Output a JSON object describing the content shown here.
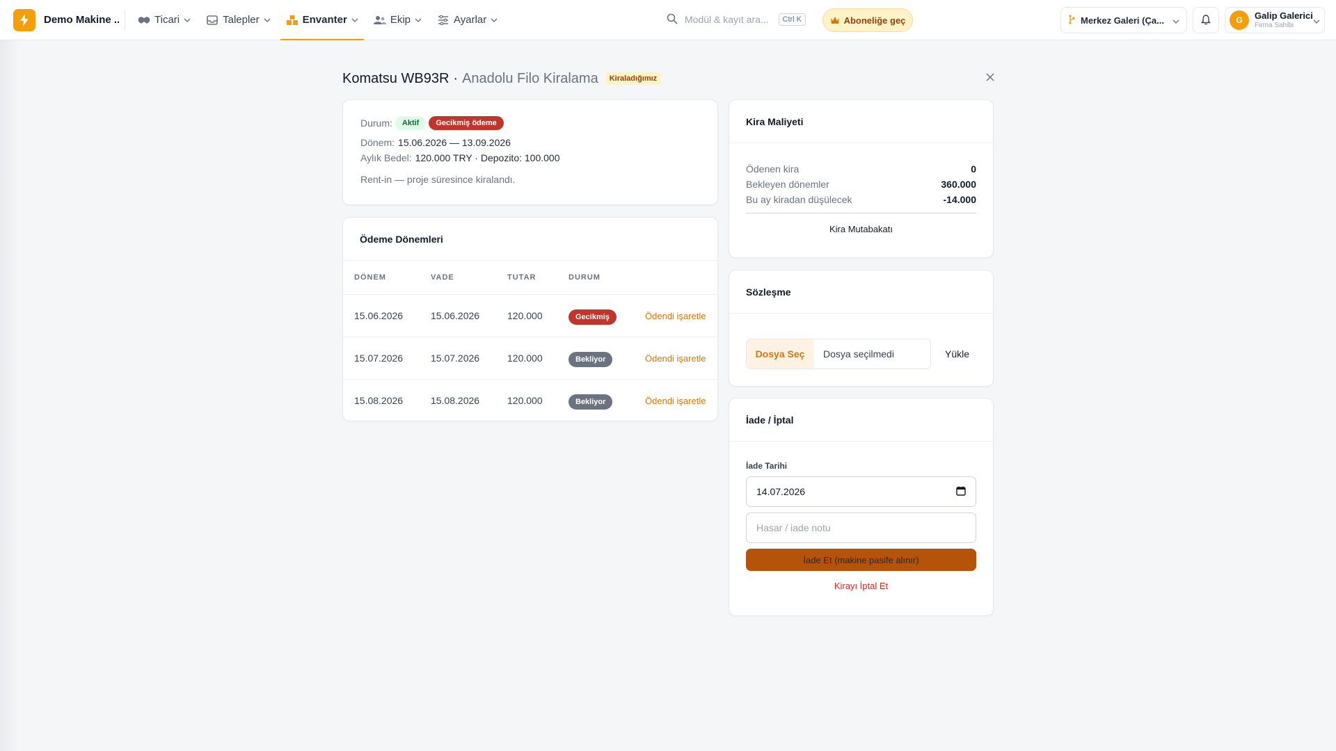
{
  "app": {
    "name": "Demo Makine ...",
    "accent": "#f59e0b"
  },
  "nav": [
    {
      "label": "Ticari",
      "icon": "handshake-icon"
    },
    {
      "label": "Talepler",
      "icon": "inbox-icon"
    },
    {
      "label": "Envanter",
      "icon": "boxes-icon",
      "active": true
    },
    {
      "label": "Ekip",
      "icon": "users-icon"
    },
    {
      "label": "Ayarlar",
      "icon": "sliders-icon"
    }
  ],
  "search": {
    "placeholder": "Modül & kayıt ara...",
    "shortcut": "Ctrl K"
  },
  "subscribe": {
    "label": "Aboneliğe geç"
  },
  "branch": {
    "label": "Merkez Galeri (Ça..."
  },
  "user": {
    "initial": "G",
    "name": "Galip Galerici",
    "role": "Firma Sahibi"
  },
  "page": {
    "title": "Komatsu WB93R",
    "separator": "·",
    "subtitle": "Anadolu Filo Kiralama",
    "badge": "Kiraladığımız"
  },
  "info": {
    "status_label": "Durum:",
    "status_active": "Aktif",
    "status_overdue": "Gecikmiş ödeme",
    "period_label": "Dönem:",
    "period_value": "15.06.2026 — 13.09.2026",
    "monthly_label": "Aylık Bedel:",
    "monthly_value": "120.000 TRY · Depozito: 100.000",
    "note": "Rent-in — proje süresince kiralandı."
  },
  "payments": {
    "title": "Ödeme Dönemleri",
    "columns": [
      "DÖNEM",
      "VADE",
      "TUTAR",
      "DURUM"
    ],
    "rows": [
      {
        "period": "15.06.2026",
        "due": "15.06.2026",
        "amount": "120.000",
        "status": "Gecikmiş",
        "action": "Ödendi işaretle"
      },
      {
        "period": "15.07.2026",
        "due": "15.07.2026",
        "amount": "120.000",
        "status": "Bekliyor",
        "action": "Ödendi işaretle"
      },
      {
        "period": "15.08.2026",
        "due": "15.08.2026",
        "amount": "120.000",
        "status": "Bekliyor",
        "action": "Ödendi işaretle"
      }
    ]
  },
  "cost": {
    "title": "Kira Maliyeti",
    "rows": [
      {
        "label": "Ödenen kira",
        "value": "0"
      },
      {
        "label": "Bekleyen dönemler",
        "value": "360.000"
      },
      {
        "label": "Bu ay kiradan düşülecek",
        "value": "-14.000"
      }
    ],
    "action": "Kira Mutabakatı"
  },
  "contract": {
    "title": "Sözleşme",
    "choose_file": "Dosya Seç",
    "no_file": "Dosya seçilmedi",
    "upload": "Yükle"
  },
  "return": {
    "title": "İade / İptal",
    "date_label": "İade Tarihi",
    "date_value": "14.07.2026",
    "note_placeholder": "Hasar / iade notu",
    "return_button": "İade Et (makine pasife alınır)",
    "cancel_link": "Kirayı İptal Et"
  }
}
